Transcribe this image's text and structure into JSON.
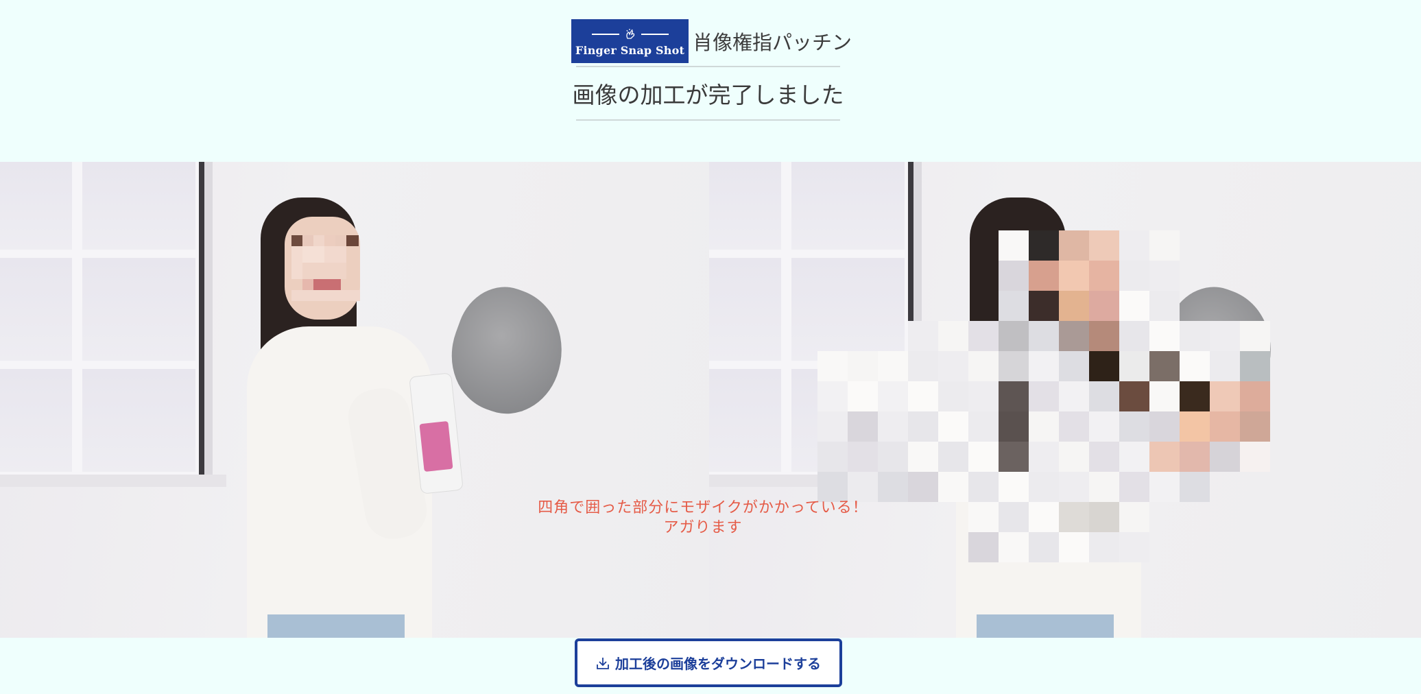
{
  "header": {
    "logo_text": "Finger Snap Shot",
    "service_name": "肖像権指パッチン",
    "page_title": "画像の加工が完了しました"
  },
  "images": {
    "mosaic_note_line1": "四角で囲った部分にモザイクがかかっている！",
    "mosaic_note_line2": "アガります"
  },
  "download": {
    "label": "加工後の画像をダウンロードする"
  },
  "colors": {
    "brand": "#1c3f9a",
    "background": "#effffd",
    "note_text": "#e55b47"
  }
}
